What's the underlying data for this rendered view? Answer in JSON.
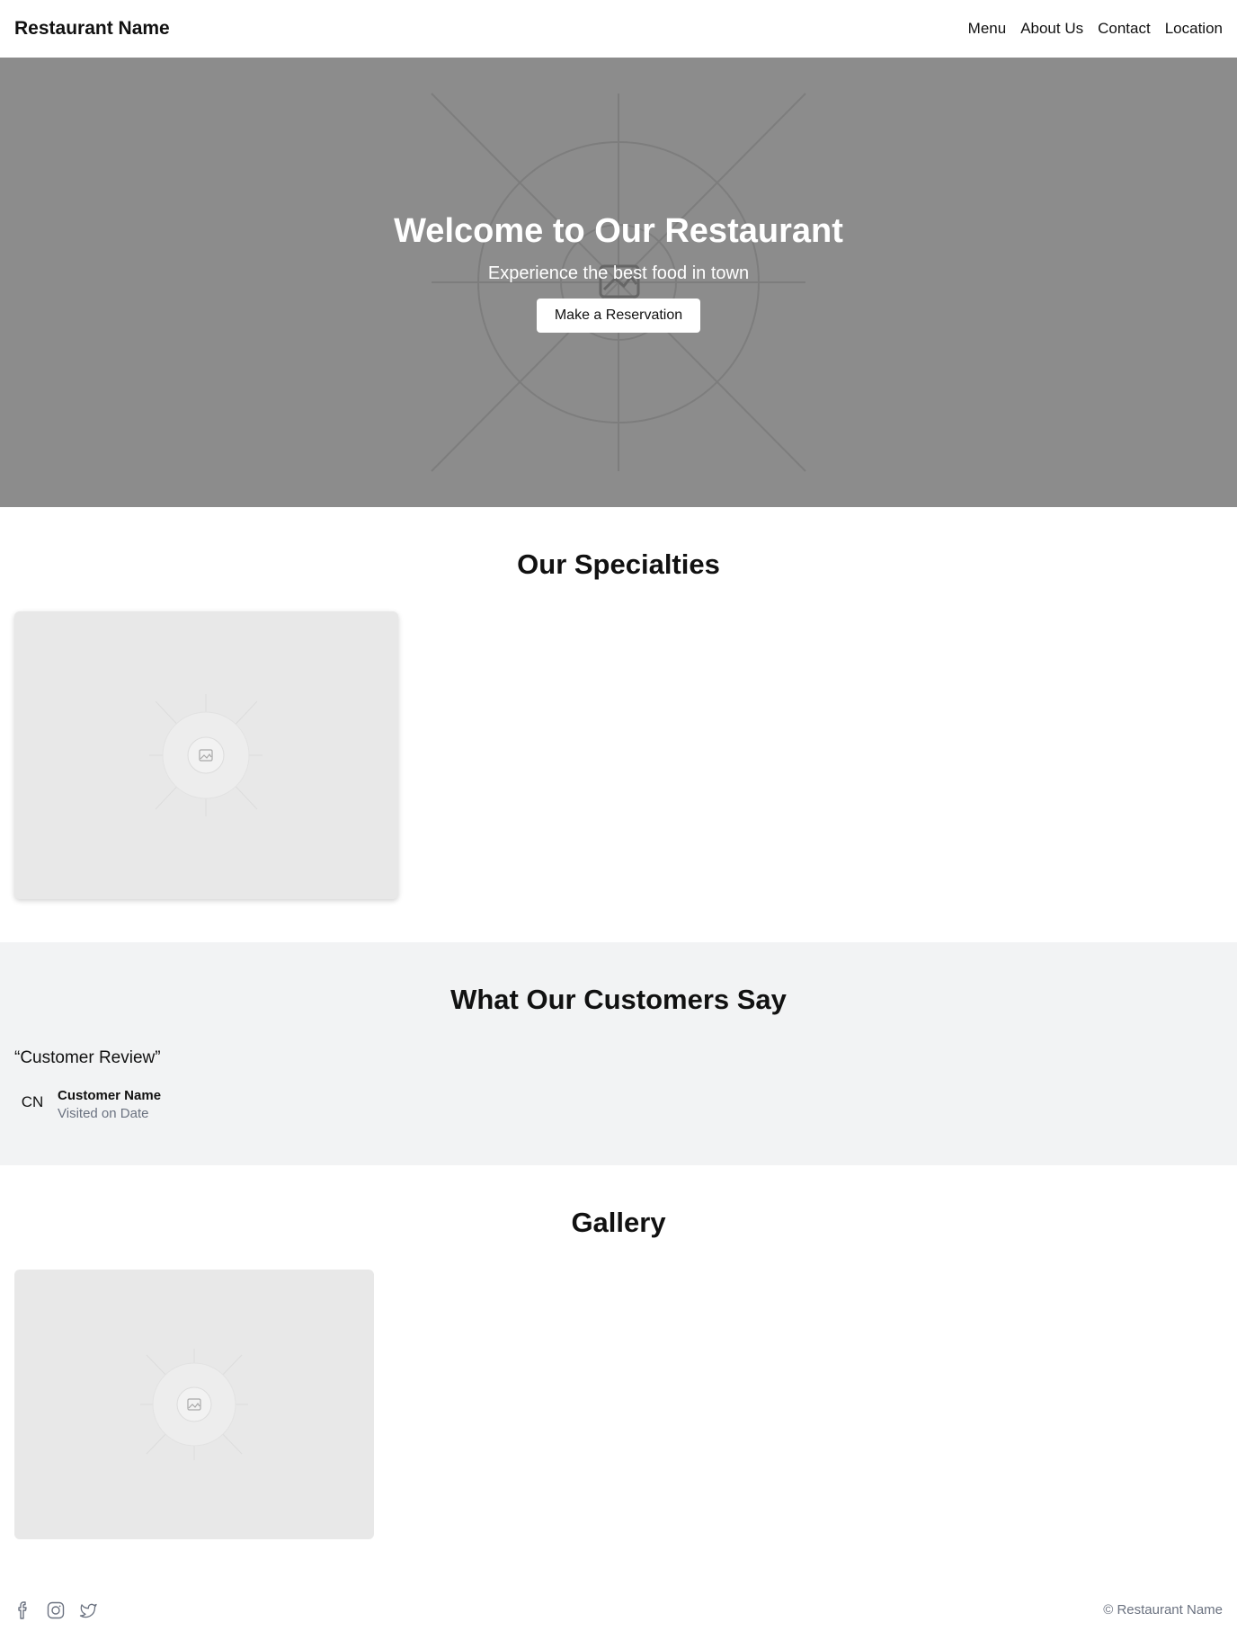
{
  "header": {
    "brand": "Restaurant Name",
    "nav": [
      "Menu",
      "About Us",
      "Contact",
      "Location"
    ]
  },
  "hero": {
    "title": "Welcome to Our Restaurant",
    "subtitle": "Experience the best food in town",
    "cta_label": "Make a Reservation",
    "background_color": "#8c8c8c"
  },
  "specialties": {
    "title": "Our Specialties"
  },
  "testimonials": {
    "title": "What Our Customers Say",
    "review": "“Customer Review”",
    "avatar_initials": "CN",
    "customer_name": "Customer Name",
    "visited": "Visited on Date"
  },
  "gallery": {
    "title": "Gallery"
  },
  "footer": {
    "social_icons": [
      "facebook-icon",
      "instagram-icon",
      "twitter-icon"
    ],
    "copyright": "© Restaurant Name"
  },
  "colors": {
    "placeholder": "#e8e8e8",
    "section_bg": "#f2f3f4",
    "muted_text": "#6b7280"
  }
}
